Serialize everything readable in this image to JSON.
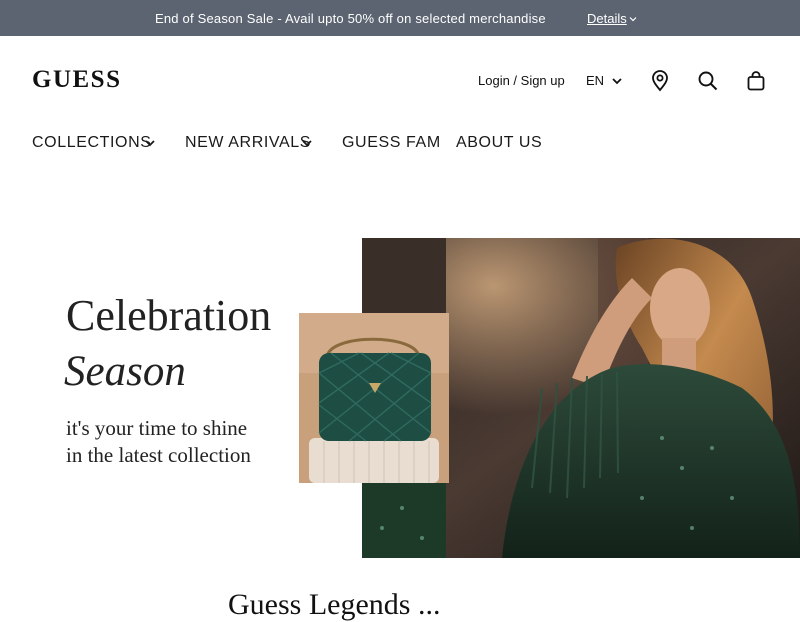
{
  "promo": {
    "message": "End of Season Sale - Avail upto 50% off on selected merchandise",
    "details_label": "Details"
  },
  "header": {
    "logo": "GUESS",
    "login_label": "Login / Sign up",
    "language": "EN"
  },
  "nav": {
    "items": [
      {
        "label": "COLLECTIONS",
        "has_dropdown": true
      },
      {
        "label": "NEW ARRIVALS",
        "has_dropdown": true
      },
      {
        "label": "GUESS FAM",
        "has_dropdown": false
      },
      {
        "label": "ABOUT US",
        "has_dropdown": false
      }
    ]
  },
  "hero": {
    "title": "Celebration",
    "subtitle": "Season",
    "tagline": "it's your time to shine in the latest collection"
  },
  "section": {
    "heading": "Guess Legends ..."
  },
  "colors": {
    "promo_bg": "#5b6470",
    "text": "#1a1a1a",
    "dress_green": "#1f3a2c"
  },
  "icons": [
    "chevron-down-icon",
    "location-pin-icon",
    "search-icon",
    "shopping-bag-icon"
  ]
}
